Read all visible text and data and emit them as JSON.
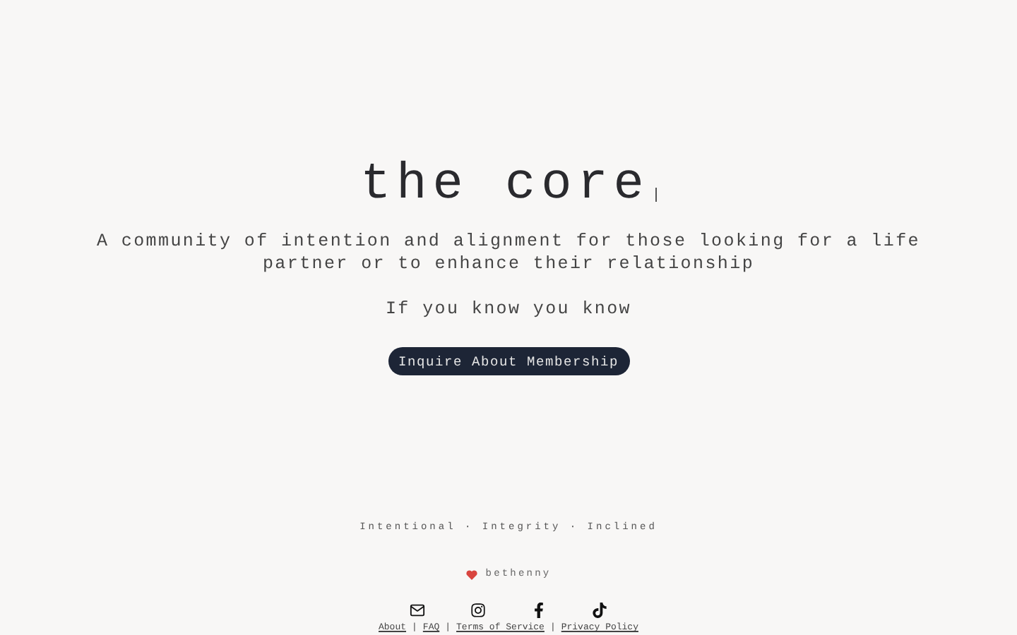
{
  "hero": {
    "title": "the core",
    "subtitle": "A community of intention and alignment for those looking for a life partner or to enhance their relationship",
    "tagline": "If you know you know",
    "button": "Inquire About Membership"
  },
  "footer": {
    "values": "Intentional · Integrity · Inclined",
    "credit": "bethenny",
    "social": [
      {
        "kind": "mail"
      },
      {
        "kind": "instagram"
      },
      {
        "kind": "facebook"
      },
      {
        "kind": "tiktok"
      }
    ],
    "links": [
      {
        "label": "About"
      },
      {
        "label": "FAQ"
      },
      {
        "label": "Terms of Service"
      },
      {
        "label": "Privacy Policy"
      }
    ],
    "separator": "|"
  }
}
